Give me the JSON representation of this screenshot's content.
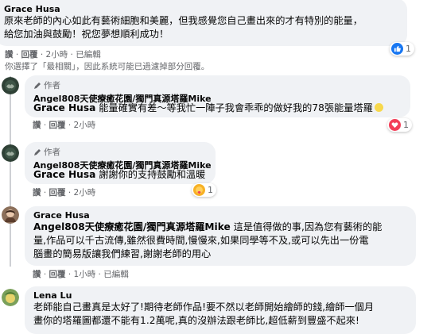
{
  "colors": {
    "bubble": "#f0f2f5",
    "meta": "#65676b",
    "like_blue": "#1877f2",
    "love_red": "#f33e58",
    "care_yellow": "#f7b125"
  },
  "comments": [
    {
      "author": "Grace Husa",
      "text_lines": [
        "原來老師的內心如此有藝術細胞和美麗，但我感覺您自己畫出來的才有特別的能量，",
        "給您加油與鼓勵！祝您夢想順利成功！"
      ],
      "meta": {
        "like": "讚",
        "reply": "回覆",
        "time": "2小時",
        "edited": "已編輯"
      },
      "reaction_count": "1",
      "filter_note": "你選擇了「最相關」，因此系統可能已過濾掉部分回覆。"
    },
    {
      "author_tag": "作者",
      "author": "Angel808天使療癒花園/獨門真源塔羅Mike",
      "mention": "Grace Husa",
      "text": " 能量確實有差～等我忙一陣子我會乖乖的做好我的78張能量塔羅",
      "meta": {
        "like": "讚",
        "reply": "回覆",
        "time": "2小時"
      },
      "reaction_count": "1"
    },
    {
      "author_tag": "作者",
      "author": "Angel808天使療癒花園/獨門真源塔羅Mike",
      "mention": "Grace Husa",
      "text": " 謝謝你的支持鼓勵和溫暖",
      "meta": {
        "like": "讚",
        "reply": "回覆",
        "time": "2小時"
      },
      "reaction_count": "1"
    },
    {
      "author": "Grace Husa",
      "mention": "Angel808天使療癒花園/獨門真源塔羅Mike",
      "text_lines": [
        " 這是值得做的事,因為您有藝術的能",
        "量,作品可以千古流傳,雖然很費時間,慢慢來,如果同學等不及,或可以先出一份電",
        "腦畫的簡易版讓我們練習,謝謝老師的用心"
      ],
      "meta": {
        "like": "讚",
        "reply": "回覆",
        "time": "1小時",
        "edited": "已編輯"
      }
    },
    {
      "author": "Lena Lu",
      "text_lines": [
        "老師能自己畫真是太好了!期待老師作品!要不然以老師開始繪師的錢,繪師一個月",
        "畫你的塔羅圖都還不能有1.2萬呢,真的沒辦法跟老師比,超低薪到豐盛不起來!"
      ]
    }
  ]
}
